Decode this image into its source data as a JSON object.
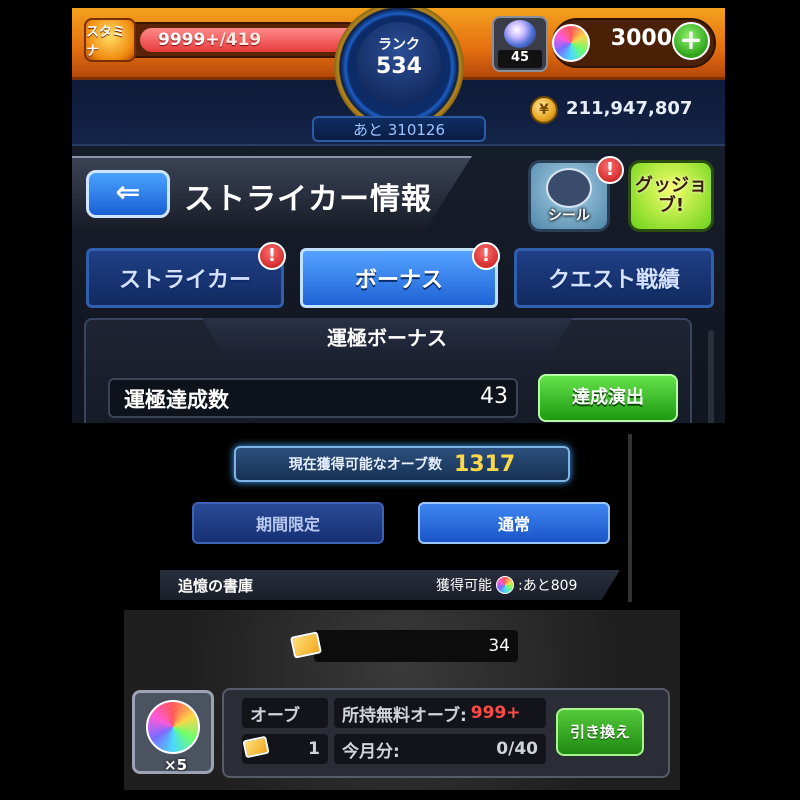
{
  "header": {
    "stamina_label": "スタミナ",
    "stamina_value": "9999+",
    "stamina_max": "/419",
    "rank_label": "ランク",
    "rank_value": "534",
    "next_rank": "あと 310126",
    "item_count": "45",
    "orb_count": "3000",
    "coin_count": "211,947,807"
  },
  "title_bar": {
    "title": "ストライカー情報",
    "seal_label": "シール",
    "good_job_label": "グッジョブ!"
  },
  "tabs": [
    {
      "label": "ストライカー",
      "active": false,
      "alert": true
    },
    {
      "label": "ボーナス",
      "active": true,
      "alert": true
    },
    {
      "label": "クエスト戦績",
      "active": false,
      "alert": false
    }
  ],
  "bonus_section": {
    "header": "運極ボーナス",
    "row_label": "運極達成数",
    "row_value": "43",
    "action_label": "達成演出"
  },
  "orb_panel": {
    "available_label": "現在獲得可能なオーブ数",
    "available_value": "1317",
    "tab_limited": "期間限定",
    "tab_normal": "通常",
    "library_title": "追憶の書庫",
    "library_obtainable": "獲得可能",
    "library_remaining": ":あと809"
  },
  "exchange_panel": {
    "ticket_count": "34",
    "orb_multiplier": "×5",
    "orb_label": "オーブ",
    "ticket_owned": "1",
    "free_orbs_label": "所持無料オーブ:",
    "free_orbs_value": "999+",
    "month_label": "今月分:",
    "month_value": "0/40",
    "exchange_button": "引き換え"
  },
  "colors": {
    "accent_orange": "#e46f10",
    "tab_blue": "#1e63d6",
    "action_green": "#1e9a12",
    "gold_text": "#ffd84a",
    "alert_red": "#c01010"
  },
  "icons": [
    "stamina-icon",
    "rank-ring-icon",
    "item-capsule-icon",
    "orb-icon",
    "plus-icon",
    "coin-icon",
    "back-arrow-icon",
    "seal-dragon-icon",
    "alert-icon",
    "good-job-icon",
    "ticket-icon"
  ]
}
